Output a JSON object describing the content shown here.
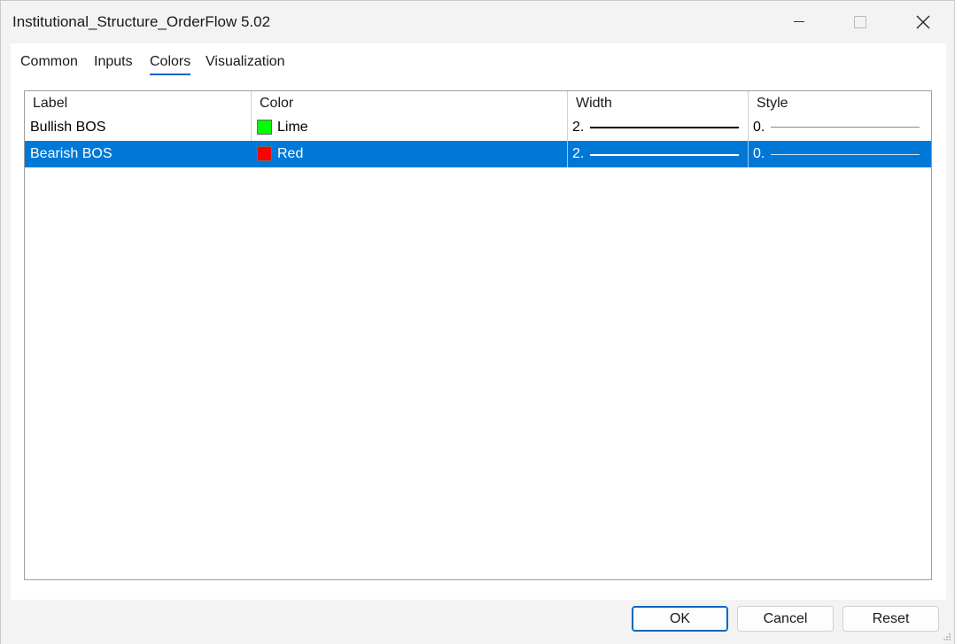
{
  "window": {
    "title": "Institutional_Structure_OrderFlow 5.02"
  },
  "tabs": [
    {
      "label": "Common",
      "active": false
    },
    {
      "label": "Inputs",
      "active": false
    },
    {
      "label": "Colors",
      "active": true
    },
    {
      "label": "Visualization",
      "active": false
    }
  ],
  "table": {
    "columns": [
      "Label",
      "Color",
      "Width",
      "Style"
    ],
    "rows": [
      {
        "label": "Bullish BOS",
        "color_name": "Lime",
        "color_hex": "#00ff00",
        "width": "2.",
        "style": "0.",
        "selected": false
      },
      {
        "label": "Bearish BOS",
        "color_name": "Red",
        "color_hex": "#ff0000",
        "width": "2.",
        "style": "0.",
        "selected": true
      }
    ]
  },
  "buttons": {
    "ok": "OK",
    "cancel": "Cancel",
    "reset": "Reset"
  },
  "colors": {
    "accent": "#0078d7",
    "tab_underline": "#0a62c8"
  }
}
